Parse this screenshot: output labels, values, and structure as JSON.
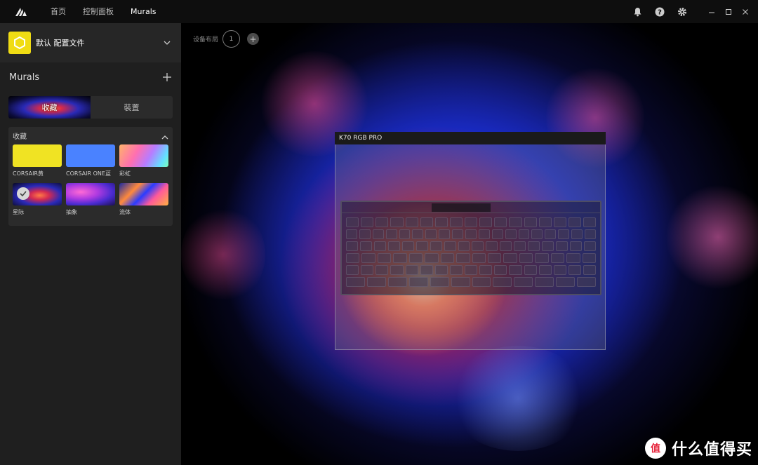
{
  "titlebar": {
    "nav": [
      "首页",
      "控制面板",
      "Murals"
    ],
    "active_index": 2,
    "icons": [
      "bell-icon",
      "help-icon",
      "gear-icon"
    ],
    "window_controls": [
      "minimize",
      "maximize",
      "close"
    ]
  },
  "profile": {
    "name": "默认 配置文件",
    "badge_color": "#f0dc14"
  },
  "murals": {
    "title": "Murals",
    "active_label": "收藏",
    "apply_label": "裝置"
  },
  "favorites": {
    "title": "收藏",
    "items": [
      {
        "label": "CORSAIR黄",
        "color": "#f0e323"
      },
      {
        "label": "CORSAIR ONE蓝",
        "color": "#4a82ff"
      },
      {
        "label": "彩虹",
        "color": "rainbow"
      },
      {
        "label": "星际",
        "color": "nebula",
        "selected": true
      },
      {
        "label": "抽象",
        "color": "abstract"
      },
      {
        "label": "流体",
        "color": "fluid"
      }
    ]
  },
  "canvas": {
    "layout_label": "设备布局",
    "layout_number": "1",
    "device_name": "K70 RGB PRO"
  },
  "watermark": {
    "text": "什么值得买",
    "logo": "值"
  }
}
